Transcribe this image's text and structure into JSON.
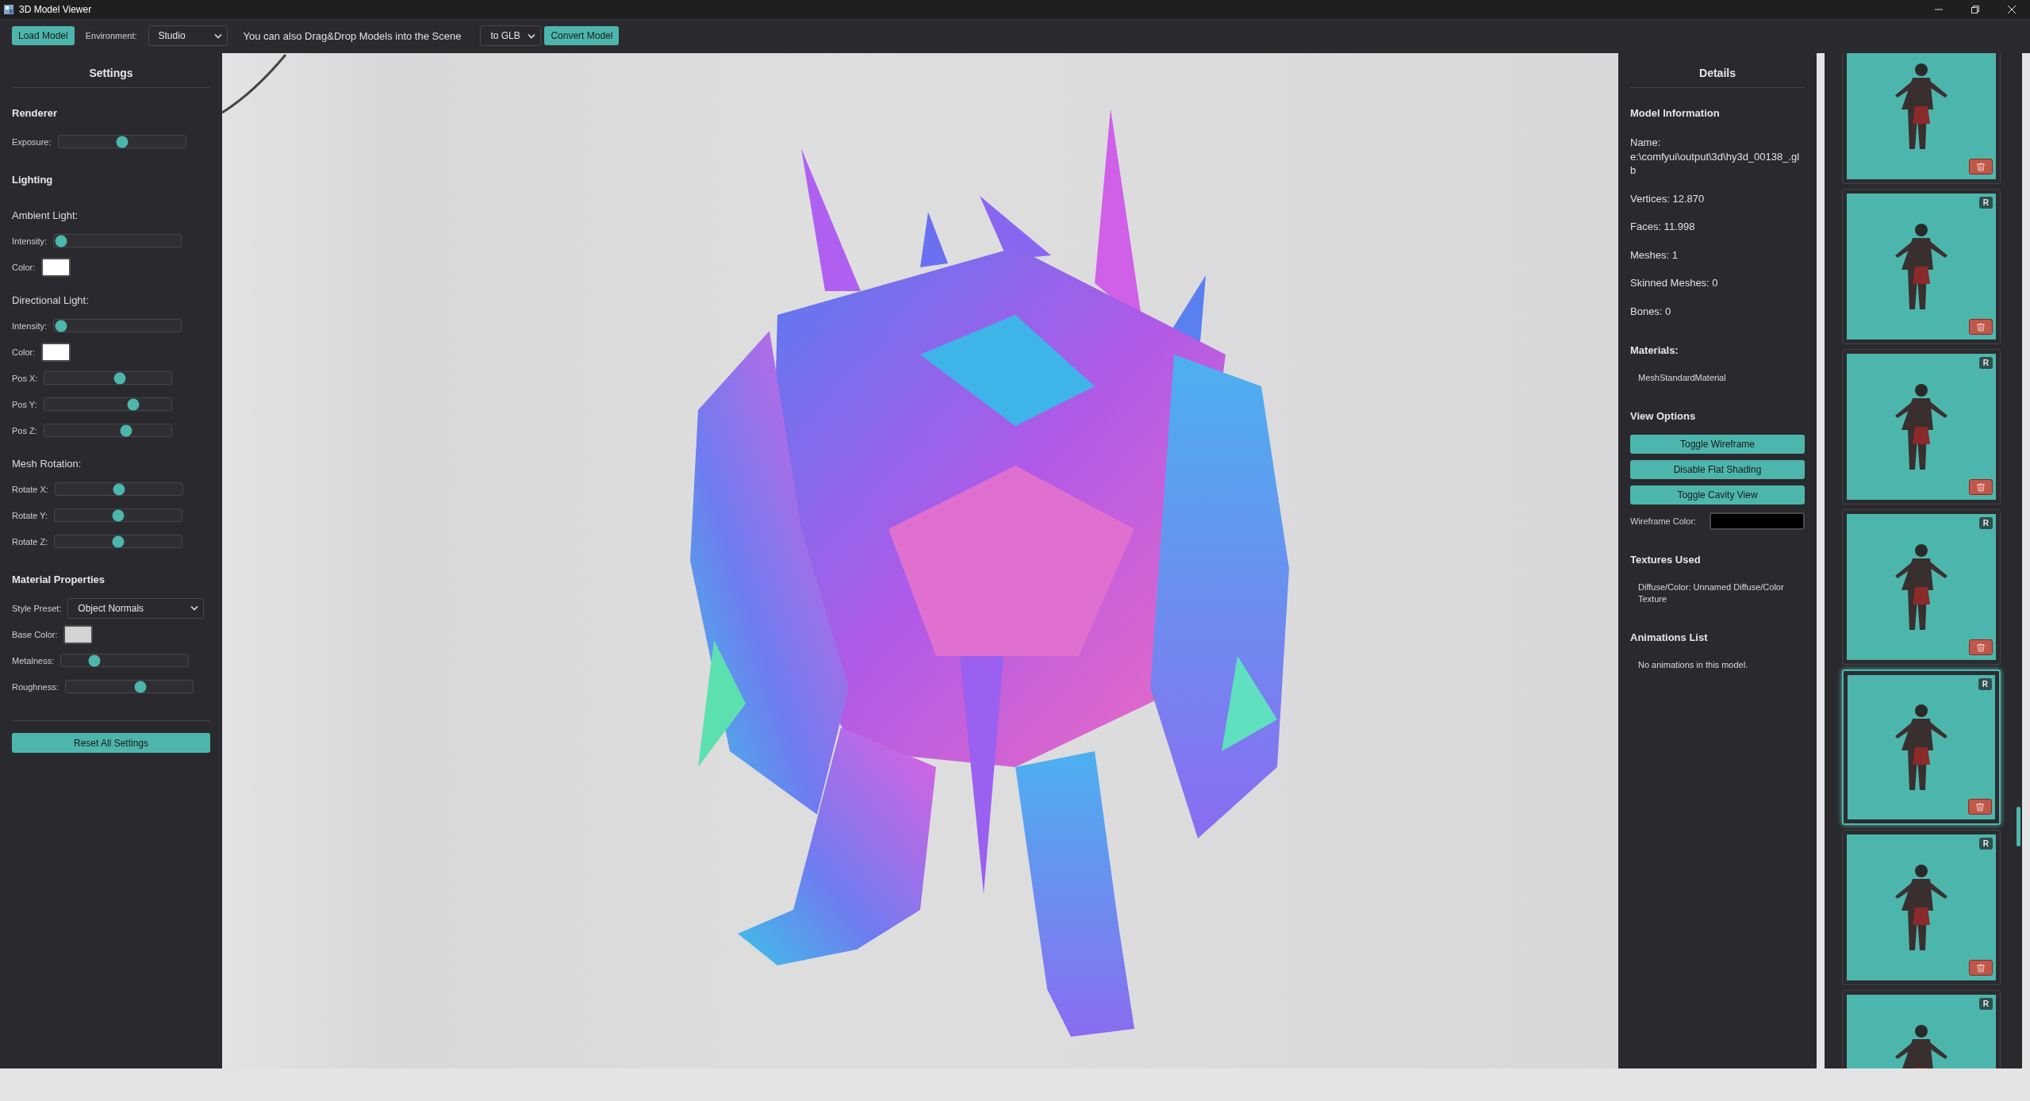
{
  "window": {
    "title": "3D Model Viewer"
  },
  "toolbar": {
    "load_button": "Load Model",
    "environment_label": "Environment:",
    "environment": "Studio",
    "hint": "You can also Drag&Drop Models into the Scene",
    "format": "to GLB",
    "convert_button": "Convert Model"
  },
  "settings": {
    "title": "Settings",
    "groups": [
      {
        "heading": "Renderer",
        "items": [
          {
            "kind": "slider",
            "label": "Exposure:",
            "level": 0.5
          }
        ]
      },
      {
        "heading": "Lighting",
        "items": [
          {
            "kind": "subheading",
            "label": "Ambient Light:"
          },
          {
            "kind": "slider",
            "label": "Intensity:",
            "level": 0.02
          },
          {
            "kind": "color",
            "label": "Color:",
            "color": "#ffffff"
          },
          {
            "kind": "subheading",
            "label": "Directional Light:"
          },
          {
            "kind": "slider",
            "label": "Intensity:",
            "level": 0.02
          },
          {
            "kind": "color",
            "label": "Color:",
            "color": "#ffffff"
          },
          {
            "kind": "slider",
            "label": "Pos X:",
            "level": 0.6
          },
          {
            "kind": "slider",
            "label": "Pos Y:",
            "level": 0.72
          },
          {
            "kind": "slider",
            "label": "Pos Z:",
            "level": 0.66
          },
          {
            "kind": "subheading",
            "label": "Mesh Rotation:"
          },
          {
            "kind": "slider",
            "label": "Rotate X:",
            "level": 0.5
          },
          {
            "kind": "slider",
            "label": "Rotate Y:",
            "level": 0.5
          },
          {
            "kind": "slider",
            "label": "Rotate Z:",
            "level": 0.5
          }
        ]
      },
      {
        "heading": "Material Properties",
        "items": [
          {
            "kind": "select",
            "label": "Style Preset:",
            "value": "Object Normals"
          },
          {
            "kind": "color",
            "label": "Base Color:",
            "color": "#d3d3d3"
          },
          {
            "kind": "slider",
            "label": "Metalness:",
            "level": 0.24
          },
          {
            "kind": "slider",
            "label": "Roughness:",
            "level": 0.6
          }
        ]
      }
    ],
    "reset_button": "Reset All Settings"
  },
  "details": {
    "title": "Details",
    "sections": [
      {
        "heading": "Model Information",
        "items": [
          {
            "kind": "text",
            "text": "Name: e:\\comfyui\\output\\3d\\hy3d_00138_.glb"
          },
          {
            "kind": "text",
            "text": "Vertices: 12.870"
          },
          {
            "kind": "text",
            "text": "Faces: 11.998"
          },
          {
            "kind": "text",
            "text": "Meshes: 1"
          },
          {
            "kind": "text",
            "text": "Skinned Meshes: 0"
          },
          {
            "kind": "text",
            "text": "Bones: 0"
          }
        ]
      },
      {
        "heading": "Materials:",
        "items": [
          {
            "kind": "indented",
            "text": "MeshStandardMaterial"
          }
        ]
      },
      {
        "heading": "View Options",
        "items": [
          {
            "kind": "button",
            "text": "Toggle Wireframe"
          },
          {
            "kind": "button",
            "text": "Disable Flat Shading"
          },
          {
            "kind": "button",
            "text": "Toggle Cavity View"
          },
          {
            "kind": "color",
            "text": "Wireframe Color:",
            "color": "#000000"
          }
        ]
      },
      {
        "heading": "Textures Used",
        "items": [
          {
            "kind": "indented",
            "text": "Diffuse/Color: Unnamed Diffuse/Color Texture"
          }
        ]
      },
      {
        "heading": "Animations List",
        "items": [
          {
            "kind": "indented",
            "text": "No animations in this model."
          }
        ]
      }
    ]
  },
  "models": [
    {
      "selected": false,
      "has_delete": true
    },
    {
      "badge": "R",
      "selected": false,
      "has_delete": true
    },
    {
      "badge": "R",
      "selected": false,
      "has_delete": true
    },
    {
      "badge": "R",
      "selected": false,
      "has_delete": true
    },
    {
      "badge": "R",
      "selected": true,
      "has_delete": true
    },
    {
      "badge": "R",
      "selected": false,
      "has_delete": true
    },
    {
      "badge": "R",
      "selected": false,
      "has_delete": false
    }
  ]
}
